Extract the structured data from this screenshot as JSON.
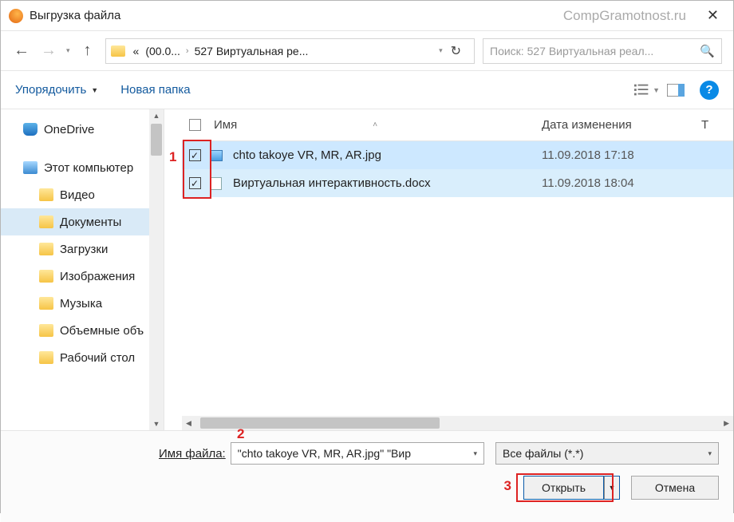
{
  "window": {
    "title": "Выгрузка файла",
    "watermark": "CompGramotnost.ru"
  },
  "nav": {
    "path_seg1": "(00.0...",
    "path_seg2": "527 Виртуальная ре...",
    "search_placeholder": "Поиск: 527 Виртуальная реал..."
  },
  "toolbar": {
    "organize": "Упорядочить",
    "new_folder": "Новая папка"
  },
  "sidebar": {
    "items": [
      {
        "label": "OneDrive",
        "icon": "onedrive"
      },
      {
        "label": "Этот компьютер",
        "icon": "pc"
      },
      {
        "label": "Видео",
        "icon": "folder",
        "sub": true
      },
      {
        "label": "Документы",
        "icon": "folder",
        "sub": true,
        "sel": true
      },
      {
        "label": "Загрузки",
        "icon": "folder",
        "sub": true
      },
      {
        "label": "Изображения",
        "icon": "folder",
        "sub": true
      },
      {
        "label": "Музыка",
        "icon": "folder",
        "sub": true
      },
      {
        "label": "Объемные объ",
        "icon": "folder",
        "sub": true
      },
      {
        "label": "Рабочий стол",
        "icon": "folder",
        "sub": true
      }
    ]
  },
  "columns": {
    "name": "Имя",
    "date": "Дата изменения",
    "type": "Т"
  },
  "files": [
    {
      "name": "chto takoye VR, MR, AR.jpg",
      "date": "11.09.2018 17:18",
      "type": "",
      "icon": "img"
    },
    {
      "name": "Виртуальная интерактивность.docx",
      "date": "11.09.2018 18:04",
      "type": "",
      "icon": "doc"
    }
  ],
  "bottom": {
    "filename_label_u": "И",
    "filename_label_rest": "мя файла:",
    "filename_value": "\"chto takoye VR, MR, AR.jpg\" \"Вир",
    "filetype_value": "Все файлы (*.*)",
    "open": "Открыть",
    "cancel": "Отмена"
  },
  "annotations": {
    "n1": "1",
    "n2": "2",
    "n3": "3"
  }
}
